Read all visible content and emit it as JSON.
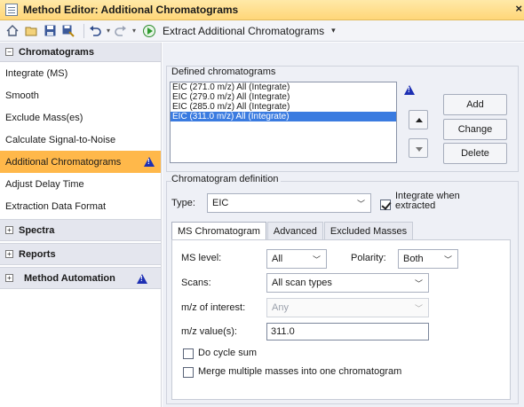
{
  "window": {
    "title": "Method Editor: Additional Chromatograms",
    "close": "×"
  },
  "toolbar": {
    "extract_label": "Extract Additional Chromatograms",
    "dropdown_arrow": "▾"
  },
  "nav": {
    "chromatograms_header": "Chromatograms",
    "items": [
      {
        "label": "Integrate (MS)"
      },
      {
        "label": "Smooth"
      },
      {
        "label": "Exclude Mass(es)"
      },
      {
        "label": "Calculate Signal-to-Noise"
      },
      {
        "label": "Additional Chromatograms"
      },
      {
        "label": "Adjust Delay Time"
      },
      {
        "label": "Extraction Data Format"
      }
    ],
    "sections": [
      {
        "label": "Spectra"
      },
      {
        "label": "Reports"
      },
      {
        "label": "Method Automation"
      }
    ],
    "collapse_symbol": "−",
    "expand_symbol": "+"
  },
  "defined": {
    "group_label": "Defined chromatograms",
    "rows": [
      "EIC (271.0 m/z) All (Integrate)",
      "EIC (279.0 m/z) All (Integrate)",
      "EIC (285.0 m/z) All (Integrate)",
      "EIC (311.0 m/z) All (Integrate)"
    ],
    "add": "Add",
    "change": "Change",
    "delete": "Delete"
  },
  "definition": {
    "group_label": "Chromatogram definition",
    "type_label": "Type:",
    "type_value": "EIC",
    "integrate_line1": "Integrate when",
    "integrate_line2": "extracted",
    "tabs": [
      "MS Chromatogram",
      "Advanced",
      "Excluded Masses"
    ],
    "ms_level_label": "MS level:",
    "ms_level_value": "All",
    "polarity_label": "Polarity:",
    "polarity_value": "Both",
    "scans_label": "Scans:",
    "scans_value": "All scan types",
    "moi_label": "m/z of interest:",
    "moi_value": "Any",
    "mz_values_label": "m/z value(s):",
    "mz_values_value": "311.0",
    "cycle_sum_label": "Do cycle sum",
    "merge_label": "Merge multiple masses into one chromatogram"
  },
  "colors": {
    "selected_nav": "#ffb84a",
    "title_bar": "#ffd678",
    "list_selection": "#3a7be0",
    "warning_icon": "#1d2fb3"
  }
}
